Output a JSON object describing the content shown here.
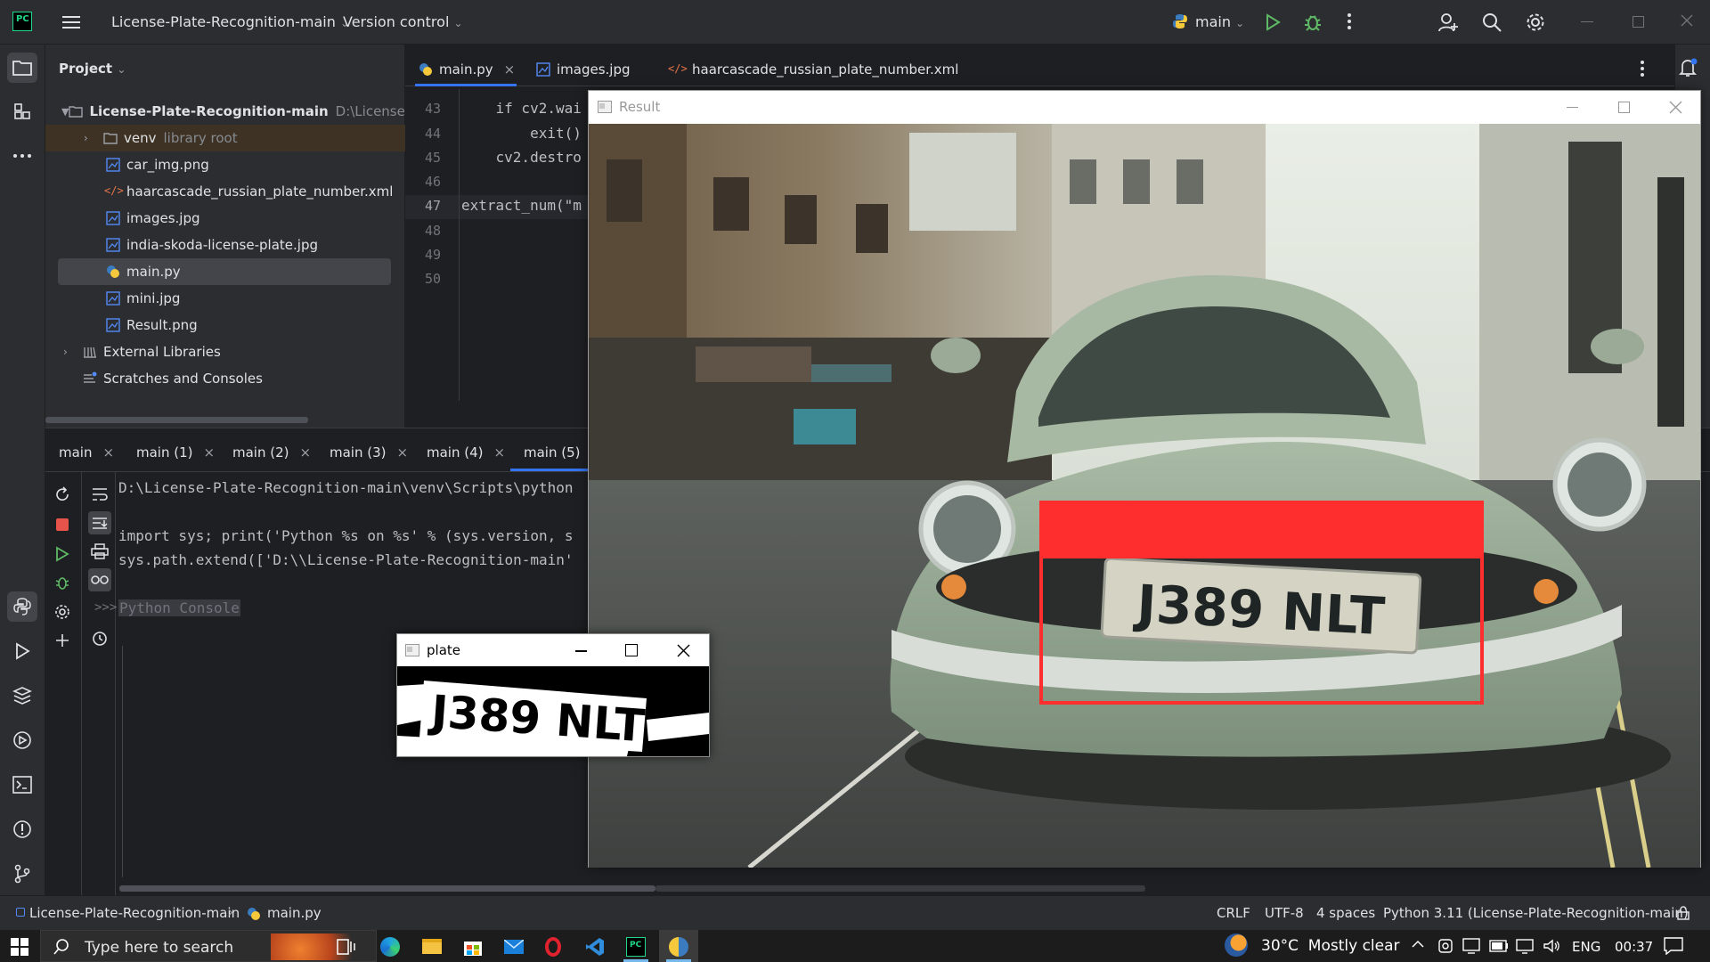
{
  "titlebar": {
    "project_name": "License-Plate-Recognition-main",
    "vcs": "Version control",
    "run_config": "main"
  },
  "project_panel": {
    "title": "Project",
    "root": {
      "name": "License-Plate-Recognition-main",
      "path": "D:\\License-Plate"
    },
    "venv": {
      "name": "venv",
      "hint": "library root"
    },
    "files": [
      "car_img.png",
      "haarcascade_russian_plate_number.xml",
      "images.jpg",
      "india-skoda-license-plate.jpg",
      "main.py",
      "mini.jpg",
      "Result.png"
    ],
    "external": "External Libraries",
    "scratches": "Scratches and Consoles"
  },
  "editor": {
    "tabs": [
      "main.py",
      "images.jpg",
      "haarcascade_russian_plate_number.xml"
    ],
    "line_numbers": [
      "43",
      "44",
      "45",
      "46",
      "47",
      "48",
      "49",
      "50"
    ],
    "code_lines": [
      "    if cv2.wai",
      "        exit()",
      "    cv2.destro",
      "",
      "extract_num(\"m",
      "",
      "",
      ""
    ]
  },
  "run": {
    "tabs": [
      "main",
      "main (1)",
      "main (2)",
      "main (3)",
      "main (4)",
      "main (5)"
    ],
    "console_lines": [
      "D:\\License-Plate-Recognition-main\\venv\\Scripts\\python",
      "",
      "import sys; print('Python %s on %s' % (sys.version, s",
      "sys.path.extend(['D:\\\\License-Plate-Recognition-main'"
    ],
    "prompt_placeholder": "Python Console"
  },
  "windows": {
    "result_title": "Result",
    "plate_title": "plate",
    "plate_text": "J389 NLT"
  },
  "statusbar": {
    "breadcrumb_project": "License-Plate-Recognition-main",
    "breadcrumb_file": "main.py",
    "line_sep": "CRLF",
    "encoding": "UTF-8",
    "indent": "4 spaces",
    "interpreter": "Python 3.11 (License-Plate-Recognition-main)"
  },
  "taskbar": {
    "search_placeholder": "Type here to search",
    "weather": "30°C  Mostly clear",
    "lang": "ENG",
    "time": "00:37"
  },
  "colors": {
    "accent": "#3574f0",
    "red_box": "#ff2e2e",
    "run_green": "#5fb865"
  }
}
